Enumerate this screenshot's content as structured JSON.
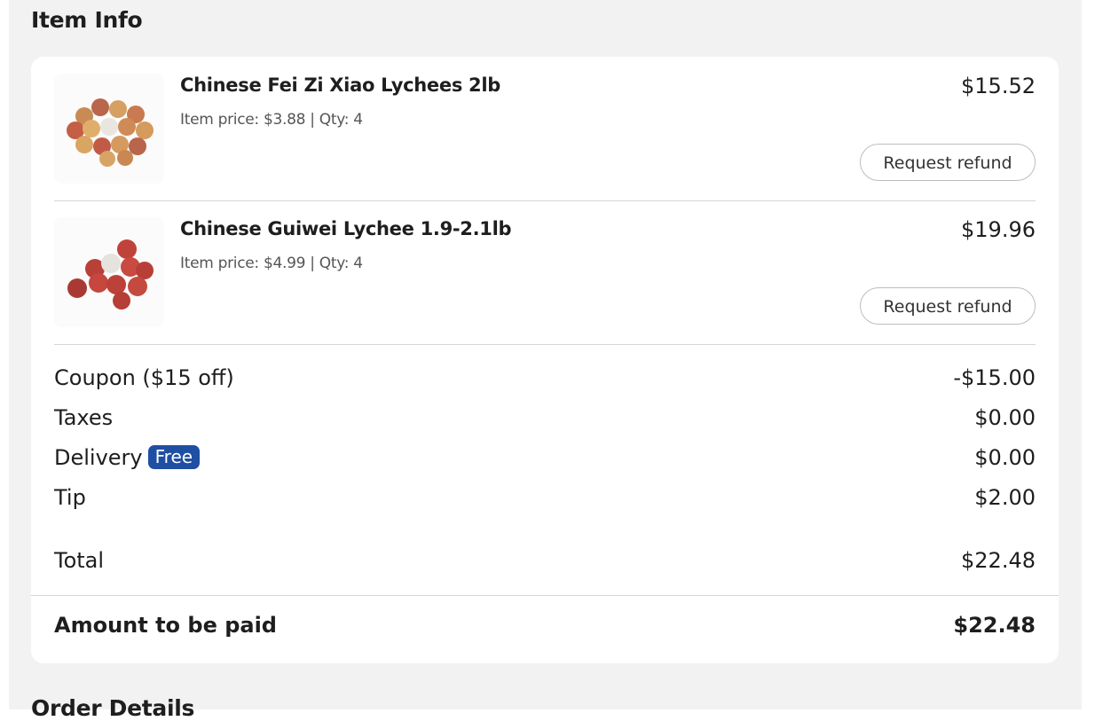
{
  "item_info": {
    "title": "Item Info",
    "items": [
      {
        "name": "Chinese Fei Zi Xiao Lychees 2lb",
        "meta": "Item price: $3.88 | Qty: 4",
        "price": "$15.52",
        "refund_label": "Request refund",
        "image_icon": "lychee-yellow-red-image"
      },
      {
        "name": "Chinese Guiwei Lychee 1.9-2.1lb",
        "meta": "Item price: $4.99 | Qty: 4",
        "price": "$19.96",
        "refund_label": "Request refund",
        "image_icon": "lychee-red-image"
      }
    ],
    "summary": {
      "coupon": {
        "label": "Coupon ($15 off)",
        "value": "-$15.00"
      },
      "taxes": {
        "label": "Taxes",
        "value": "$0.00"
      },
      "delivery": {
        "label": "Delivery",
        "badge": "Free",
        "value": "$0.00"
      },
      "tip": {
        "label": "Tip",
        "value": "$2.00"
      },
      "total": {
        "label": "Total",
        "value": "$22.48"
      }
    },
    "amount_to_pay": {
      "label": "Amount to be paid",
      "value": "$22.48"
    }
  },
  "next_section": {
    "title": "Order Details"
  },
  "colors": {
    "badge_blue": "#1f4fa3",
    "panel_bg": "#f2f2f2",
    "card_bg": "#ffffff"
  }
}
